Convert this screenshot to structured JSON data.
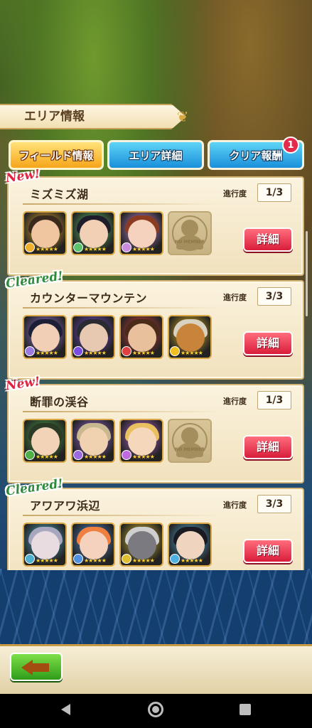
{
  "header": {
    "title": "エリア情報"
  },
  "tabs": [
    {
      "label": "フィールド情報",
      "active": true
    },
    {
      "label": "エリア詳細",
      "active": false
    },
    {
      "label": "クリア報酬",
      "active": false,
      "badge": "1"
    }
  ],
  "progress_label": "進行度",
  "detail_label": "詳細",
  "empty_slot_text": "NO MEMBER",
  "fields": [
    {
      "tag": "New!",
      "tag_type": "new",
      "name": "ミズミズ湖",
      "progress": "1/3",
      "members": [
        "a",
        "b",
        "c",
        "empty"
      ]
    },
    {
      "tag": "Cleared!",
      "tag_type": "cleared",
      "name": "カウンターマウンテン",
      "progress": "3/3",
      "members": [
        "d",
        "e",
        "f",
        "g"
      ]
    },
    {
      "tag": "New!",
      "tag_type": "new",
      "name": "断罪の渓谷",
      "progress": "1/3",
      "members": [
        "h",
        "i",
        "j",
        "empty"
      ]
    },
    {
      "tag": "Cleared!",
      "tag_type": "cleared",
      "name": "アワアワ浜辺",
      "progress": "3/3",
      "members": [
        "k",
        "l",
        "m",
        "n"
      ]
    }
  ],
  "colors": {
    "new_tag": "#e0243f",
    "cleared_tag": "#2d8a3a",
    "detail_button": "#d91d3b",
    "active_tab": "#f6a51a",
    "inactive_tab": "#1a8fdb"
  },
  "icons": {
    "back": "back-arrow-icon",
    "nav_back": "triangle-back-icon",
    "nav_home": "circle-home-icon",
    "nav_recent": "square-recent-icon"
  }
}
